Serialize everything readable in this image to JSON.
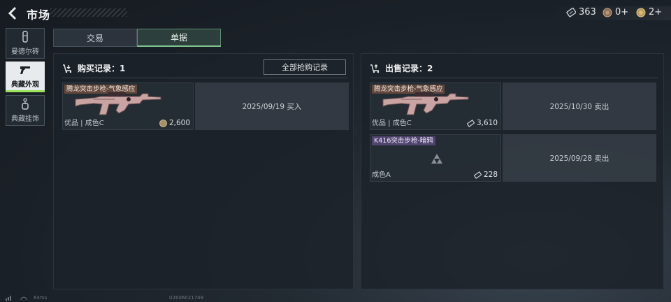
{
  "header": {
    "title": "市场",
    "currencies": [
      {
        "icon": "ticket-icon",
        "value": "363"
      },
      {
        "icon": "coin-icon",
        "value": "0+"
      },
      {
        "icon": "gold-coin-icon",
        "value": "2+"
      }
    ]
  },
  "sidebar": {
    "items": [
      {
        "label": "曼德尔砖",
        "icon": "brick-icon",
        "active": false
      },
      {
        "label": "典藏外观",
        "icon": "pistol-icon",
        "active": true
      },
      {
        "label": "典藏挂饰",
        "icon": "charm-icon",
        "active": false
      }
    ]
  },
  "tabs": [
    {
      "label": "交易",
      "active": false
    },
    {
      "label": "单据",
      "active": true
    }
  ],
  "purchase": {
    "header": "购买记录：1",
    "all_button": "全部抢购记录",
    "records": [
      {
        "name": "腾龙突击步枪-气象感应",
        "quality": "优品 | 成色C",
        "price": "2,600",
        "price_icon": "coin-icon",
        "date": "2025/09/19 买入"
      }
    ]
  },
  "sales": {
    "header": "出售记录：2",
    "records": [
      {
        "name": "腾龙突击步枪-气象感应",
        "quality": "优品 | 成色C",
        "price": "3,610",
        "price_icon": "ticket-icon",
        "date": "2025/10/30 卖出"
      },
      {
        "name": "K416突击步枪-暗鸦",
        "quality": "成色A",
        "price": "228",
        "price_icon": "ticket-icon",
        "date": "2025/09/28 卖出"
      }
    ]
  },
  "footer": {
    "ping": "64ms",
    "uid": "02606021749"
  },
  "colors": {
    "accent_green": "#7fc48f",
    "active_bar": "#9be35a",
    "name_tag_orange": "#965f46",
    "name_tag_purple": "#6e5596"
  }
}
